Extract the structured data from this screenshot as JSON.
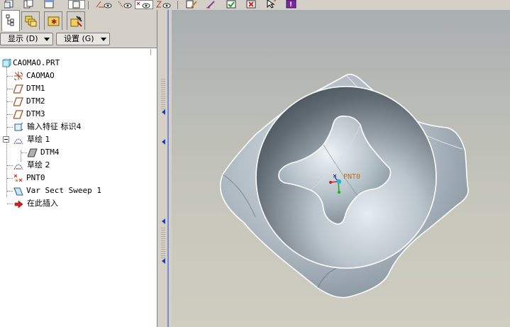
{
  "toolbar": {
    "icons": [
      "sketch-datum-display-icon",
      "axis-display-icon",
      "point-display-icon",
      "csys-display-icon",
      "edit-icon",
      "redline-icon",
      "check-icon",
      "close-icon",
      "select-icon",
      "info-icon"
    ]
  },
  "nav": {
    "tabs": [
      "model-tree-tab",
      "layer-tree-tab",
      "favorites-tab",
      "connections-tab"
    ],
    "menus": {
      "show": "显示 (D)",
      "settings": "设置 (G)"
    }
  },
  "tree": [
    {
      "label": "CAOMAO.PRT",
      "icon": "part-icon"
    },
    {
      "label": "CAOMAO",
      "icon": "csys-icon"
    },
    {
      "label": "DTM1",
      "icon": "datum-plane-icon"
    },
    {
      "label": "DTM2",
      "icon": "datum-plane-icon"
    },
    {
      "label": "DTM3",
      "icon": "datum-plane-icon"
    },
    {
      "label": "输入特征 标识4",
      "icon": "import-feature-icon"
    },
    {
      "label": "草绘 1",
      "icon": "sketch-icon",
      "expand": "−"
    },
    {
      "label": "DTM4",
      "icon": "datum-plane-icon"
    },
    {
      "label": "草绘 2",
      "icon": "sketch-icon"
    },
    {
      "label": "PNT0",
      "icon": "datum-point-icon"
    },
    {
      "label": "Var Sect Sweep 1",
      "icon": "sweep-icon"
    },
    {
      "label": "在此插入",
      "icon": "insert-arrow-icon"
    }
  ],
  "viewport": {
    "point_label": "PNT0",
    "colors": {
      "surface": "#b7c1c9",
      "edge": "#ffffff",
      "point": "#cc2222",
      "axis_green": "#22aa22",
      "axis_cyan": "#22b8d8"
    }
  }
}
